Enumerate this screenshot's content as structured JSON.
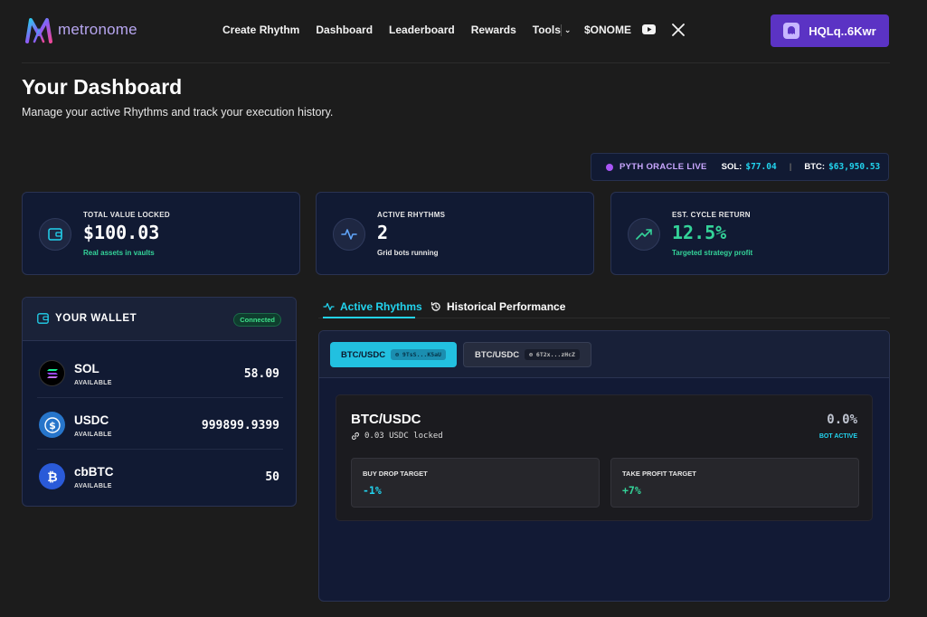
{
  "nav": {
    "brand": "metronome",
    "links": [
      "Create Rhythm",
      "Dashboard",
      "Leaderboard",
      "Rewards"
    ],
    "tools_label": "Tools",
    "token_label": "$ONOME",
    "wallet_label": "HQLq..6Kwr"
  },
  "page": {
    "title": "Your Dashboard",
    "subtitle": "Manage your active Rhythms and track your execution history."
  },
  "oracle": {
    "label": "PYTH ORACLE LIVE",
    "sol_label": "SOL:",
    "sol_price": "$77.04",
    "btc_label": "BTC:",
    "btc_price": "$63,950.53"
  },
  "stats": [
    {
      "label": "TOTAL VALUE LOCKED",
      "value": "$100.03",
      "note": "Real assets in vaults",
      "note_color": "#34d399",
      "icon": "wallet-icon"
    },
    {
      "label": "ACTIVE RHYTHMS",
      "value": "2",
      "note": "Grid bots running",
      "note_color": "#e6e6e6",
      "icon": "activity-icon"
    },
    {
      "label": "EST. CYCLE RETURN",
      "value": "12.5%",
      "note": "Targeted strategy profit",
      "note_color": "#34d399",
      "icon": "trending-up-icon"
    }
  ],
  "wallet": {
    "title": "YOUR WALLET",
    "status": "Connected",
    "assets": [
      {
        "name": "SOL",
        "sub": "AVAILABLE",
        "balance": "58.09",
        "icon": "solana-icon"
      },
      {
        "name": "USDC",
        "sub": "AVAILABLE",
        "balance": "999899.9399",
        "icon": "usdc-icon"
      },
      {
        "name": "cbBTC",
        "sub": "AVAILABLE",
        "balance": "50",
        "icon": "bitcoin-icon"
      }
    ]
  },
  "tabs": {
    "active": "Active Rhythms",
    "history": "Historical Performance"
  },
  "rhythms": {
    "chips": [
      {
        "pair": "BTC/USDC",
        "addr": "⊕ 9TsS...K5aU"
      },
      {
        "pair": "BTC/USDC",
        "addr": "⊕ 6T2x...zHcZ"
      }
    ],
    "bot": {
      "title": "BTC/USDC",
      "locked": "0.03 USDC locked",
      "percent": "0.0%",
      "status": "BOT ACTIVE",
      "buy_label": "BUY DROP TARGET",
      "buy_value": "-1%",
      "tp_label": "TAKE PROFIT TARGET",
      "tp_value": "+7%"
    }
  },
  "colors": {
    "accent_cyan": "#22d3ee",
    "accent_purple": "#5b33c4",
    "positive": "#34d399"
  }
}
